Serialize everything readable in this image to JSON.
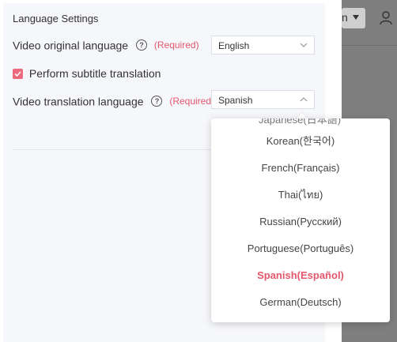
{
  "header": {
    "right_select_value": "n"
  },
  "panel": {
    "section_title": "Language Settings",
    "original": {
      "label": "Video original language",
      "required": "(Required)",
      "value": "English"
    },
    "subtitle_translation": {
      "label": "Perform subtitle translation",
      "checked": true
    },
    "translation": {
      "label": "Video translation language",
      "required": "(Required)",
      "value": "Spanish"
    }
  },
  "dropdown": {
    "partial_top": "Japanese(日本語)",
    "options": [
      {
        "label": "Korean(한국어)",
        "selected": false
      },
      {
        "label": "French(Français)",
        "selected": false
      },
      {
        "label": "Thai(ไทย)",
        "selected": false
      },
      {
        "label": "Russian(Русский)",
        "selected": false
      },
      {
        "label": "Portuguese(Português)",
        "selected": false
      },
      {
        "label": "Spanish(Español)",
        "selected": true
      },
      {
        "label": "German(Deutsch)",
        "selected": false
      }
    ]
  },
  "colors": {
    "accent": "#e5566b",
    "checkbox": "#ec6a7b",
    "panel_bg": "#f6f7fb"
  },
  "icons": {
    "help": "question-circle-icon",
    "chevron": "chevron-icon",
    "user": "user-icon"
  }
}
